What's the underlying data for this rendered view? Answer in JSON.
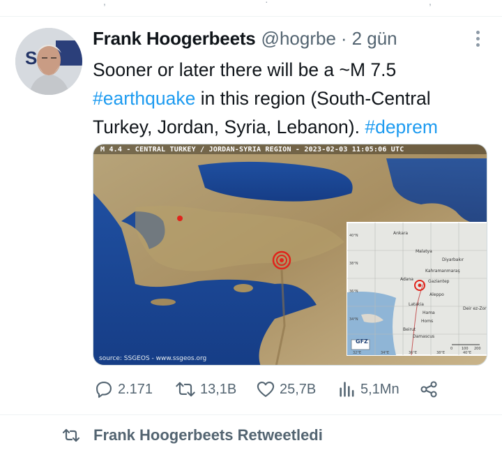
{
  "tweet": {
    "author_name": "Frank Hoogerbeets",
    "handle": "@hogrbe",
    "separator": "·",
    "time": "2 gün",
    "text": {
      "part1": "Sooner or later there will be a ~M 7.5 ",
      "hashtag1": "#earthquake",
      "part2": " in this region (South-Central Turkey, Jordan, Syria, Lebanon). ",
      "hashtag2": "#deprem"
    },
    "media": {
      "map_title": "M 4.4 - CENTRAL TURKEY / JORDAN-SYRIA REGION - 2023-02-03 11:05:06 UTC",
      "source": "source: SSGEOS - www.ssgeos.org",
      "inset_badge": "GFZ",
      "inset_labels": [
        "Ankara",
        "Malatya",
        "Diyarbakır",
        "Kahramanmaraş",
        "Adana",
        "Gaziantep",
        "Aleppo",
        "Latakia",
        "Hama",
        "Homs",
        "Beirut",
        "Damascus",
        "Deir ez-Zor"
      ],
      "inset_lat_labels": [
        "40°N",
        "38°N",
        "36°N",
        "34°N"
      ],
      "inset_lon_labels": [
        "32°E",
        "34°E",
        "36°E",
        "38°E",
        "40°E"
      ],
      "inset_scale": [
        "0",
        "100",
        "200"
      ]
    },
    "stats": {
      "replies": "2.171",
      "retweets": "13,1B",
      "likes": "25,7B",
      "views": "5,1Mn"
    }
  },
  "next_item": {
    "retweet_label": "Frank Hoogerbeets Retweetledi"
  },
  "icons": {
    "reply": "reply-icon",
    "retweet": "retweet-icon",
    "like": "heart-icon",
    "views": "views-icon",
    "share": "share-icon",
    "more": "more-icon"
  },
  "colors": {
    "accent": "#1d9bf0",
    "secondary_text": "#536471",
    "epicenter": "#e0241b"
  }
}
